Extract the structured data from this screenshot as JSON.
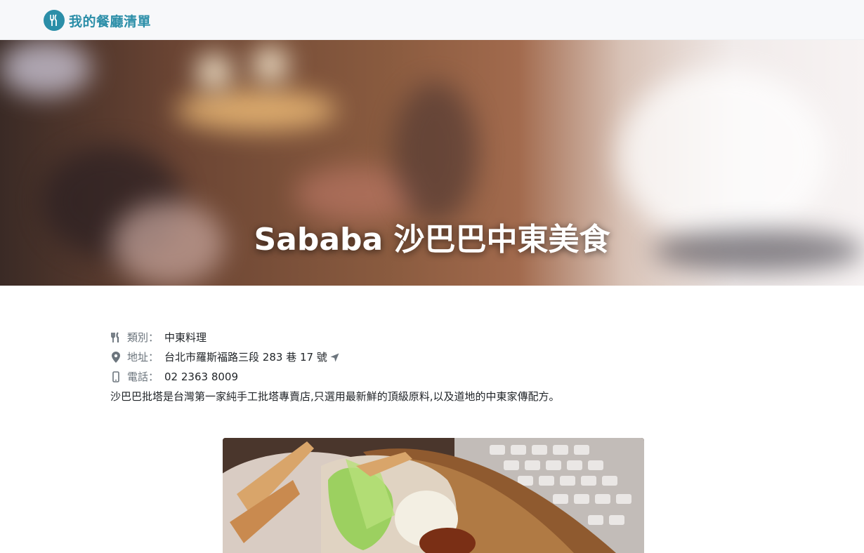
{
  "navbar": {
    "brand_icon": "utensils-icon",
    "brand_text": "我的餐廳清單"
  },
  "banner": {
    "title": "Sababa 沙巴巴中東美食"
  },
  "info": {
    "category": {
      "icon": "utensils-icon",
      "label": "類別：",
      "value": "中東料理"
    },
    "address": {
      "icon": "map-marker-icon",
      "label": "地址：",
      "value": "台北市羅斯福路三段 283 巷 17 號",
      "action_icon": "location-arrow-icon"
    },
    "phone": {
      "icon": "mobile-icon",
      "label": "電話：",
      "value": "02 2363 8009"
    },
    "description": "沙巴巴批塔是台灣第一家純手工批塔專賣店,只選用最新鮮的頂級原料,以及道地的中東家傳配方。"
  },
  "colors": {
    "brand": "#2b8ea8",
    "label_gray": "#6c757d",
    "navbar_bg": "#f7f8fa"
  }
}
